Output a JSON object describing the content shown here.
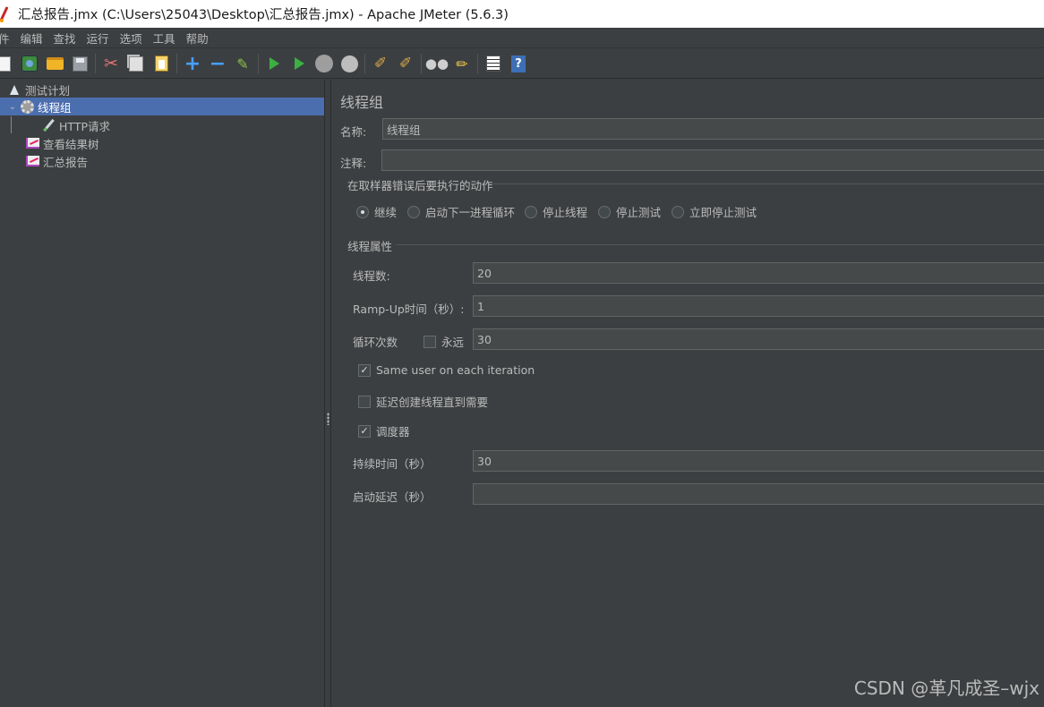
{
  "window": {
    "title": "汇总报告.jmx (C:\\Users\\25043\\Desktop\\汇总报告.jmx) - Apache JMeter (5.6.3)"
  },
  "menu": {
    "items": [
      "件",
      "编辑",
      "查找",
      "运行",
      "选项",
      "工具",
      "帮助"
    ]
  },
  "toolbar": {
    "icons": [
      "new-icon",
      "templates-icon",
      "open-icon",
      "save-icon",
      "cut-icon",
      "copy-icon",
      "paste-icon",
      "expand-icon",
      "collapse-icon",
      "toggle-icon",
      "start-icon",
      "start-no-timers-icon",
      "stop-icon",
      "shutdown-icon",
      "clear-icon",
      "clear-all-icon",
      "search-icon",
      "reset-search-icon",
      "function-helper-icon",
      "help-icon"
    ]
  },
  "tree": {
    "items": [
      {
        "label": "测试计划",
        "icon": "flask-icon"
      },
      {
        "label": "线程组",
        "icon": "gear-icon",
        "selected": true,
        "expanded": true
      },
      {
        "label": "HTTP请求",
        "icon": "pen-icon"
      },
      {
        "label": "查看结果树",
        "icon": "graph-icon"
      },
      {
        "label": "汇总报告",
        "icon": "graph-icon"
      }
    ]
  },
  "panel": {
    "title": "线程组",
    "name_label": "名称:",
    "name_value": "线程组",
    "comment_label": "注释:",
    "comment_value": "",
    "error_action": {
      "title": "在取样器错误后要执行的动作",
      "options": [
        "继续",
        "启动下一进程循环",
        "停止线程",
        "停止测试",
        "立即停止测试"
      ],
      "selected_index": 0
    },
    "thread_props": {
      "title": "线程属性",
      "threads_label": "线程数:",
      "threads_value": "20",
      "rampup_label": "Ramp-Up时间（秒）:",
      "rampup_value": "1",
      "loop_label": "循环次数",
      "forever_label": "永远",
      "forever_checked": false,
      "loop_value": "30",
      "same_user_label": "Same user on each iteration",
      "same_user_checked": true,
      "delay_label": "延迟创建线程直到需要",
      "delay_checked": false,
      "scheduler_label": "调度器",
      "scheduler_checked": true,
      "duration_label": "持续时间（秒）",
      "duration_value": "30",
      "startup_delay_label": "启动延迟（秒）",
      "startup_delay_value": ""
    }
  },
  "watermark": "CSDN @革凡成圣–wjx"
}
